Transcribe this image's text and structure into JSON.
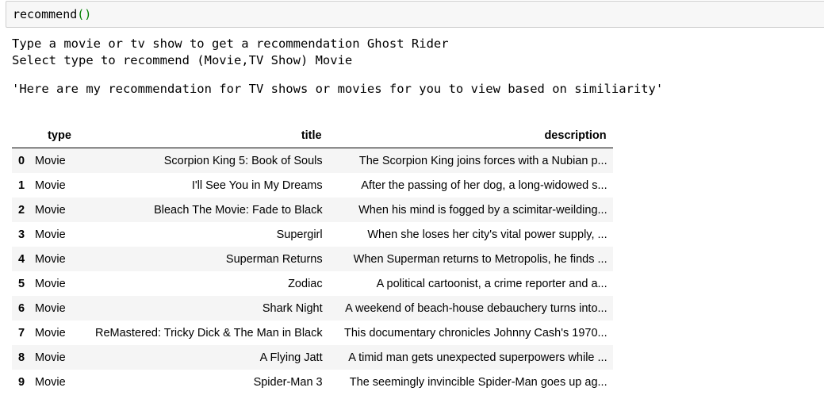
{
  "cell": {
    "func": "recommend",
    "parens": "()"
  },
  "stdout": {
    "line1": "Type a movie or tv show to get a recommendation Ghost Rider",
    "line2": "Select type to recommend (Movie,TV Show) Movie"
  },
  "result": "'Here are my recommendation for TV shows or movies for you to view based on similiarity'",
  "table": {
    "headers": [
      "",
      "type",
      "title",
      "description"
    ],
    "rows": [
      {
        "idx": "0",
        "type": "Movie",
        "title": "Scorpion King 5: Book of Souls",
        "description": "The Scorpion King joins forces with a Nubian p..."
      },
      {
        "idx": "1",
        "type": "Movie",
        "title": "I'll See You in My Dreams",
        "description": "After the passing of her dog, a long-widowed s..."
      },
      {
        "idx": "2",
        "type": "Movie",
        "title": "Bleach The Movie: Fade to Black",
        "description": "When his mind is fogged by a scimitar-weilding..."
      },
      {
        "idx": "3",
        "type": "Movie",
        "title": "Supergirl",
        "description": "When she loses her city's vital power supply, ..."
      },
      {
        "idx": "4",
        "type": "Movie",
        "title": "Superman Returns",
        "description": "When Superman returns to Metropolis, he finds ..."
      },
      {
        "idx": "5",
        "type": "Movie",
        "title": "Zodiac",
        "description": "A political cartoonist, a crime reporter and a..."
      },
      {
        "idx": "6",
        "type": "Movie",
        "title": "Shark Night",
        "description": "A weekend of beach-house debauchery turns into..."
      },
      {
        "idx": "7",
        "type": "Movie",
        "title": "ReMastered: Tricky Dick & The Man in Black",
        "description": "This documentary chronicles Johnny Cash's 1970..."
      },
      {
        "idx": "8",
        "type": "Movie",
        "title": "A Flying Jatt",
        "description": "A timid man gets unexpected superpowers while ..."
      },
      {
        "idx": "9",
        "type": "Movie",
        "title": "Spider-Man 3",
        "description": "The seemingly invincible Spider-Man goes up ag..."
      }
    ]
  }
}
